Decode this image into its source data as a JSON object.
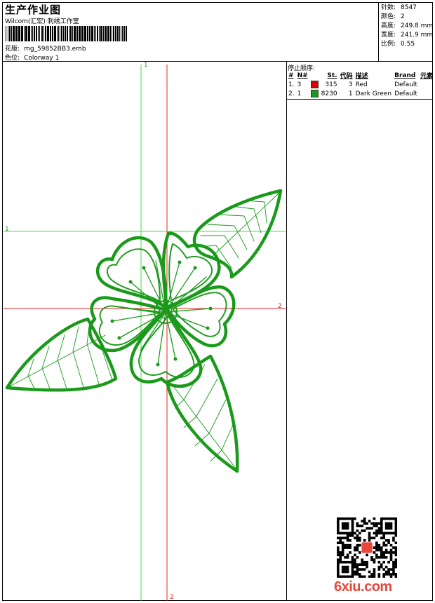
{
  "header": {
    "title": "生产作业图",
    "subtitle": "Wilcom(汇宏) 刺绣工作室",
    "design": {
      "label": "花版:",
      "value": "mg_59852BB3.emb"
    },
    "colorway": {
      "label": "色位:",
      "value": "Colorway 1"
    }
  },
  "info": [
    {
      "label": "针数:",
      "value": "8547"
    },
    {
      "label": "颜色:",
      "value": "2"
    },
    {
      "label": "高度:",
      "value": "249.8 mm"
    },
    {
      "label": "宽度:",
      "value": "241.9 mm"
    },
    {
      "label": "比例:",
      "value": "0.55"
    }
  ],
  "stop_sequence": {
    "title": "停止顺序:",
    "columns": [
      "#",
      "N#",
      "St.",
      "代码",
      "描述",
      "Brand",
      "元素"
    ],
    "rows": [
      {
        "no": "1.",
        "needle": "3",
        "color": "#dd0000",
        "stitches": "315",
        "code": "3",
        "desc": "Red",
        "brand": "Default"
      },
      {
        "no": "2.",
        "needle": "1",
        "color": "#1a9a1a",
        "stitches": "8230",
        "code": "1",
        "desc": "Dark Green",
        "brand": "Default"
      }
    ]
  },
  "axes": {
    "green_v_label": "1",
    "green_h_label": "1",
    "red_h_label": "2",
    "red_v_label": "2"
  },
  "colors": {
    "stitch_green": "#1a9a1a",
    "guide_green": "#44dd44",
    "guide_red": "#ee2222",
    "watermark": "#e8473a"
  },
  "watermark": "6xiu.com"
}
